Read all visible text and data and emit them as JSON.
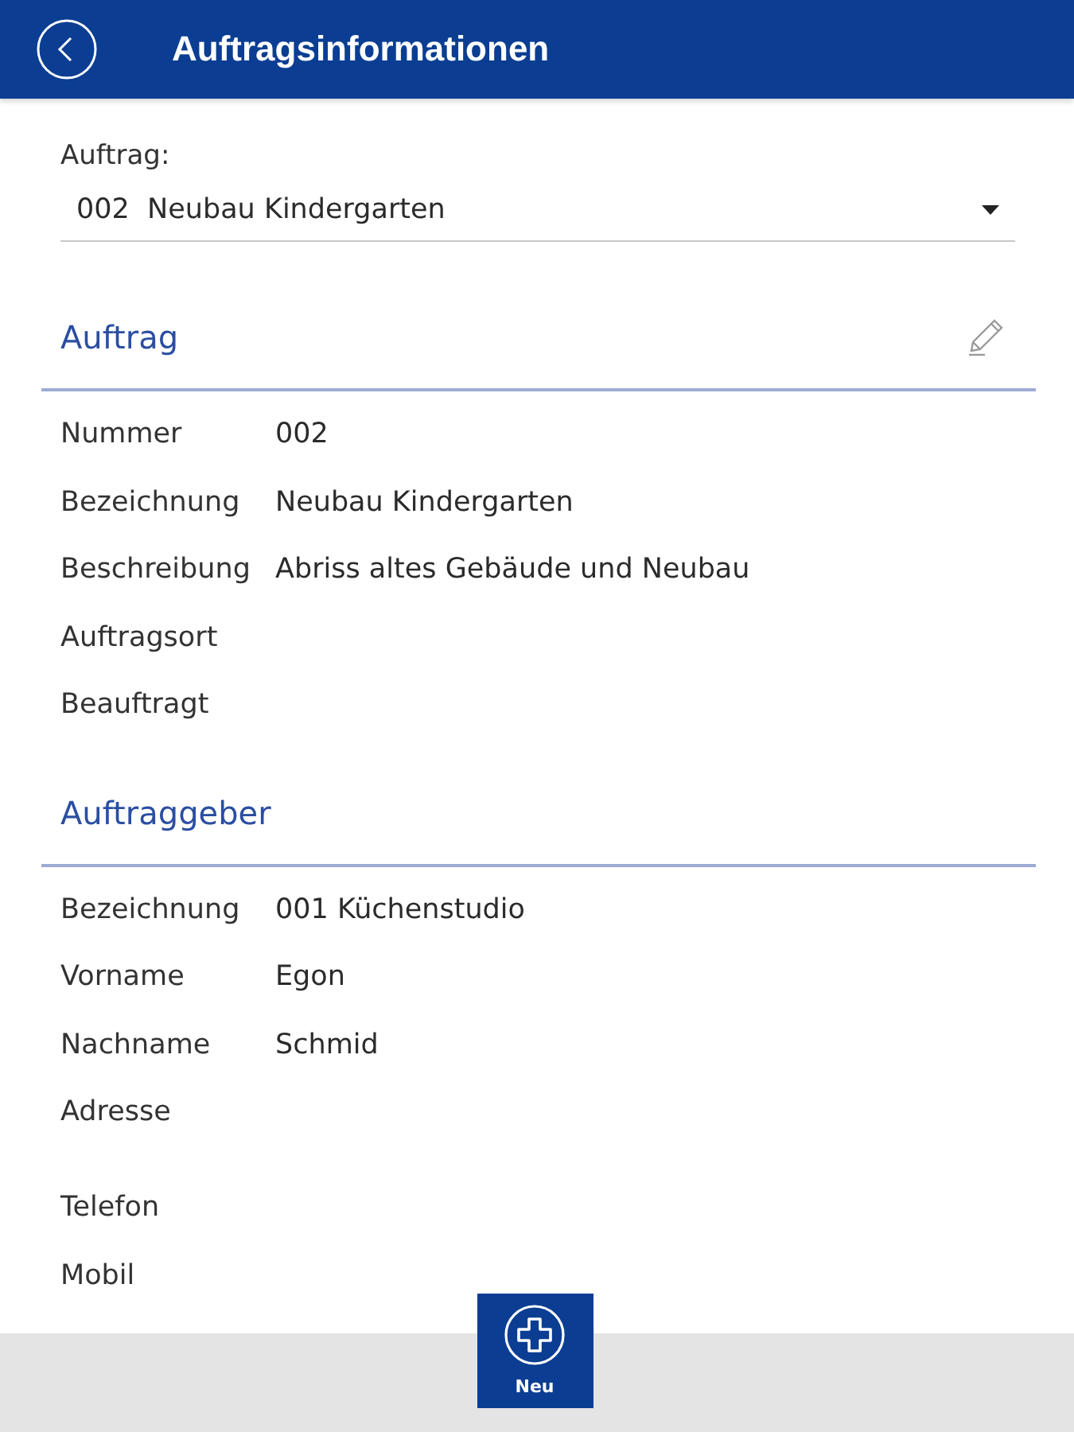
{
  "header": {
    "title": "Auftragsinformationen"
  },
  "order_picker": {
    "label": "Auftrag:",
    "value": "002  Neubau Kindergarten"
  },
  "sections": [
    {
      "title": "Auftrag",
      "editable": true,
      "fields": [
        {
          "kind": "text",
          "label": "Nummer",
          "value": "002"
        },
        {
          "kind": "text",
          "label": "Bezeichnung",
          "value": "Neubau Kindergarten"
        },
        {
          "kind": "text",
          "label": "Beschreibung",
          "value": "Abriss altes Gebäude und Neubau"
        },
        {
          "kind": "text",
          "label": "Auftragsort"
        },
        {
          "kind": "text",
          "label": "Beauftragt"
        }
      ]
    },
    {
      "title": "Auftraggeber",
      "editable": false,
      "fields": [
        {
          "kind": "text",
          "label": "Bezeichnung",
          "value": "001 Küchenstudio"
        },
        {
          "kind": "text",
          "label": "Vorname",
          "value": "Egon"
        },
        {
          "kind": "text",
          "label": "Nachname",
          "value": "Schmid"
        },
        {
          "kind": "address",
          "label": "Adresse"
        },
        {
          "kind": "text",
          "label": "Telefon"
        },
        {
          "kind": "text",
          "label": "Mobil"
        }
      ]
    }
  ],
  "bottom_bar": {
    "buttons": [
      {
        "label": "Neu"
      }
    ]
  }
}
